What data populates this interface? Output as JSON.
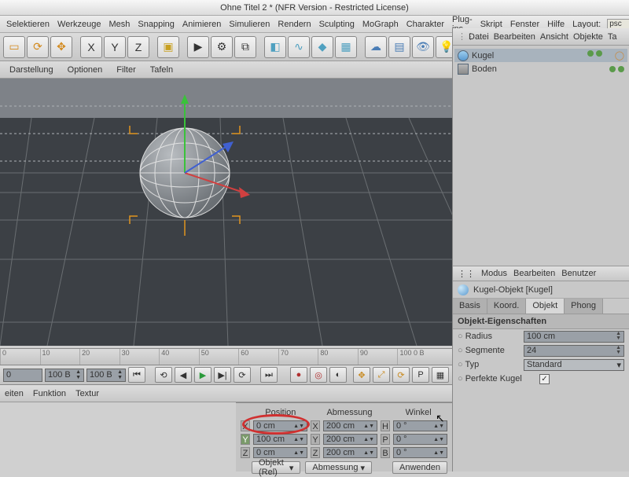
{
  "window": {
    "title": "Ohne Titel 2 * (NFR Version - Restricted License)"
  },
  "menu": {
    "items": [
      "Selektieren",
      "Werkzeuge",
      "Mesh",
      "Snapping",
      "Animieren",
      "Simulieren",
      "Rendern",
      "Sculpting",
      "MoGraph",
      "Charakter",
      "Plug-ins",
      "Skript",
      "Fenster",
      "Hilfe"
    ],
    "layout_label": "Layout:",
    "layout_value": "psc"
  },
  "subbar": {
    "items": [
      "Darstellung",
      "Optionen",
      "Filter",
      "Tafeln"
    ]
  },
  "right_panel": {
    "tabs": [
      "Datei",
      "Bearbeiten",
      "Ansicht",
      "Objekte",
      "Ta"
    ],
    "objects": [
      {
        "name": "Kugel",
        "selected": true
      },
      {
        "name": "Boden",
        "selected": false
      }
    ],
    "attr_tabs": [
      "Modus",
      "Bearbeiten",
      "Benutzer"
    ],
    "attr_title": "Kugel-Objekt [Kugel]",
    "attr_tabs2": [
      "Basis",
      "Koord.",
      "Objekt",
      "Phong"
    ],
    "section_title": "Objekt-Eigenschaften",
    "props": {
      "radius_label": "Radius",
      "radius_value": "100 cm",
      "segments_label": "Segmente",
      "segments_value": "24",
      "type_label": "Typ",
      "type_value": "Standard",
      "perfect_label": "Perfekte Kugel"
    }
  },
  "ruler": {
    "ticks": [
      "0",
      "10",
      "20",
      "30",
      "40",
      "50",
      "60",
      "70",
      "80",
      "90",
      "100             0 B"
    ]
  },
  "framebar": {
    "start": "0",
    "cur": "100 B",
    "end": "100 B"
  },
  "bottom": {
    "items": [
      "eiten",
      "Funktion",
      "Textur"
    ]
  },
  "coord": {
    "headers": [
      "Position",
      "Abmessung",
      "Winkel"
    ],
    "rows": [
      {
        "axis": "X",
        "pos": "0 cm",
        "dim": "200 cm",
        "axis2": "H",
        "ang": "0 °"
      },
      {
        "axis": "Y",
        "pos": "100 cm",
        "dim": "200 cm",
        "axis2": "P",
        "ang": "0 °"
      },
      {
        "axis": "Z",
        "pos": "0 cm",
        "dim": "200 cm",
        "axis2": "B",
        "ang": "0 °"
      }
    ],
    "btn_obj": "Objekt (Rel)",
    "btn_dim": "Abmessung",
    "btn_apply": "Anwenden"
  }
}
